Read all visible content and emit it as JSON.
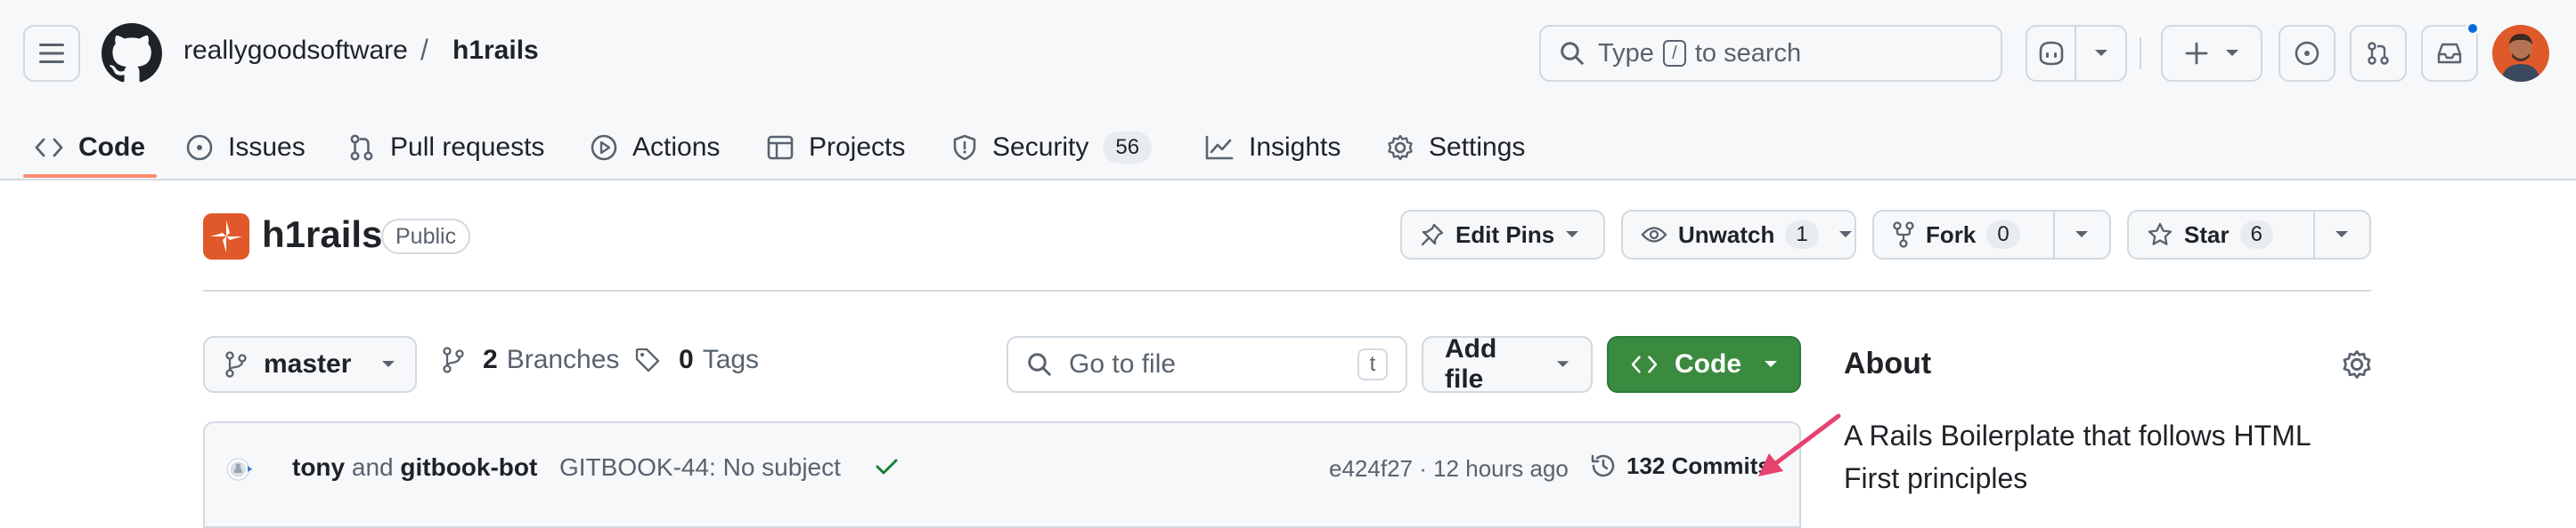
{
  "header": {
    "owner": "reallygoodsoftware",
    "separator": "/",
    "repo": "h1rails",
    "search": {
      "prefix": "Type",
      "key": "/",
      "suffix": "to search"
    },
    "icons": [
      "hamburger-icon",
      "github-logo",
      "search-icon",
      "copilot-icon",
      "plus-icon",
      "issue-icon",
      "pull-request-icon",
      "inbox-icon"
    ]
  },
  "nav": {
    "tabs": [
      {
        "label": "Code",
        "icon": "code-icon",
        "active": true
      },
      {
        "label": "Issues",
        "icon": "issue-opened-icon"
      },
      {
        "label": "Pull requests",
        "icon": "git-pull-request-icon"
      },
      {
        "label": "Actions",
        "icon": "play-icon"
      },
      {
        "label": "Projects",
        "icon": "table-icon"
      },
      {
        "label": "Security",
        "icon": "shield-icon",
        "count": "56"
      },
      {
        "label": "Insights",
        "icon": "graph-icon"
      },
      {
        "label": "Settings",
        "icon": "gear-icon"
      }
    ]
  },
  "repo": {
    "name": "h1rails",
    "visibility": "Public",
    "edit_pins": "Edit Pins",
    "unwatch": "Unwatch",
    "watch_count": "1",
    "fork": "Fork",
    "fork_count": "0",
    "star": "Star",
    "star_count": "6"
  },
  "files": {
    "branch": "master",
    "branches_count": "2",
    "branches_label": "Branches",
    "tags_count": "0",
    "tags_label": "Tags",
    "goto_placeholder": "Go to file",
    "goto_key": "t",
    "add_file": "Add file",
    "code": "Code"
  },
  "commit": {
    "author1": "tony",
    "and": "and",
    "author2": "gitbook-bot",
    "message": "GITBOOK-44: No subject",
    "hash_time": "e424f27 · 12 hours ago",
    "commits_label": "132 Commits"
  },
  "about": {
    "title": "About",
    "description": "A Rails Boilerplate that follows HTML First principles"
  },
  "colors": {
    "accent_underline": "#fd8c73",
    "code_button": "#3a8a3f",
    "annotation_arrow": "#e8416f",
    "notification": "#0969da"
  }
}
